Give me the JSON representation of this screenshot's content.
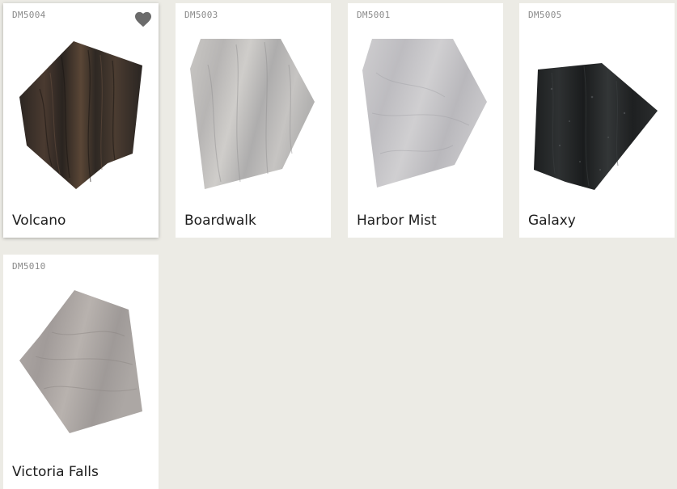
{
  "products": [
    {
      "code": "DM5004",
      "name": "Volcano",
      "favorited": true,
      "icon": "heart-icon"
    },
    {
      "code": "DM5003",
      "name": "Boardwalk",
      "favorited": false
    },
    {
      "code": "DM5001",
      "name": "Harbor Mist",
      "favorited": false
    },
    {
      "code": "DM5005",
      "name": "Galaxy",
      "favorited": false
    },
    {
      "code": "DM5010",
      "name": "Victoria Falls",
      "favorited": false
    }
  ],
  "colors": {
    "page_background": "#ecebe5",
    "card_background": "#ffffff",
    "code_text": "#8a8a8a",
    "name_text": "#1c1c1c",
    "favorite_icon": "#6b6b6b"
  }
}
